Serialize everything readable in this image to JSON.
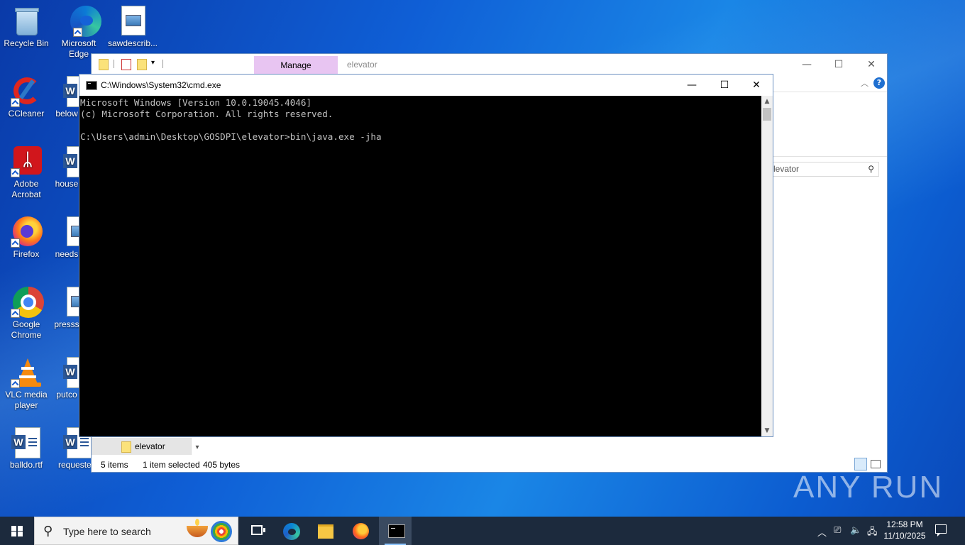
{
  "desktop": {
    "icons": [
      {
        "label": "Recycle Bin"
      },
      {
        "label": "Microsoft Edge"
      },
      {
        "label": "sawdescrib..."
      },
      {
        "label": "CCleaner"
      },
      {
        "label": "below"
      },
      {
        "label": "Adobe Acrobat"
      },
      {
        "label": "house"
      },
      {
        "label": "Firefox"
      },
      {
        "label": "needs"
      },
      {
        "label": "Google Chrome"
      },
      {
        "label": "presss"
      },
      {
        "label": "VLC media player"
      },
      {
        "label": "putco"
      },
      {
        "label": "balldo.rtf"
      },
      {
        "label": "requeste"
      }
    ]
  },
  "explorer": {
    "manage_tab": "Manage",
    "window_name": "elevator",
    "search_placeholder": "levator",
    "nav_item": "elevator",
    "status": {
      "items": "5 items",
      "selected": "1 item selected",
      "size": "405 bytes"
    },
    "help_label": "?"
  },
  "cmd": {
    "title": "C:\\Windows\\System32\\cmd.exe",
    "lines": [
      "Microsoft Windows [Version 10.0.19045.4046]",
      "(c) Microsoft Corporation. All rights reserved.",
      "",
      "C:\\Users\\admin\\Desktop\\GOSDPI\\elevator>bin\\java.exe -jha"
    ]
  },
  "watermark": "ANY RUN",
  "taskbar": {
    "search_placeholder": "Type here to search",
    "time": "12:58 PM",
    "date": "11/10/2025"
  },
  "colors": {
    "desktop_bg": "#0f5fd6",
    "taskbar_bg": "#1c2a3d",
    "manage_tab": "#e8c5f2",
    "console_bg": "#000000",
    "console_fg": "#c0c0c0"
  }
}
